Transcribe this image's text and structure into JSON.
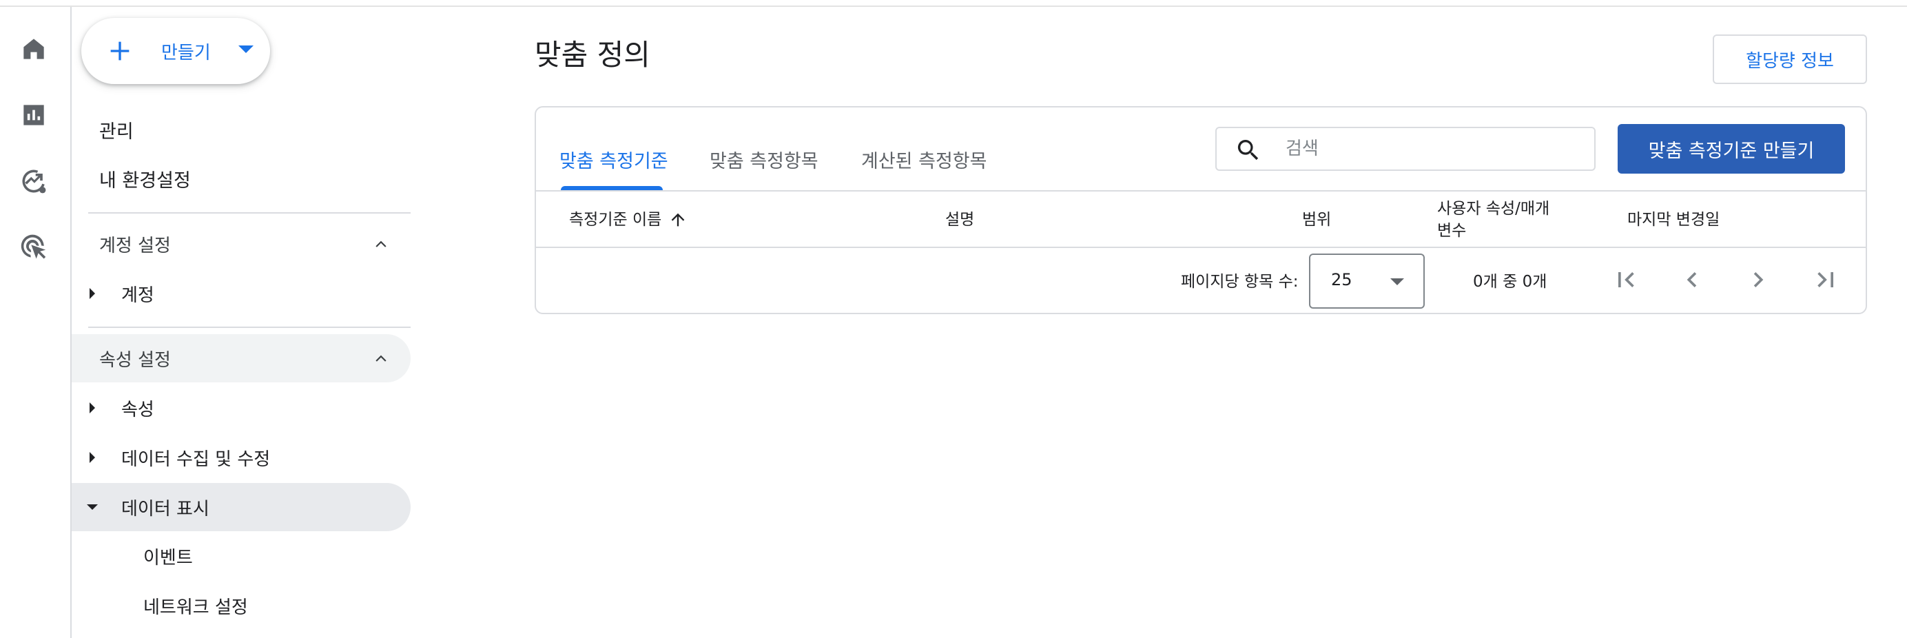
{
  "rail": {
    "icons": [
      "home-icon",
      "reports-icon",
      "explore-icon",
      "advertising-icon"
    ]
  },
  "nav": {
    "create_label": "만들기",
    "admin_label": "관리",
    "prefs_label": "내 환경설정",
    "account_settings_label": "계정 설정",
    "account_label": "계정",
    "property_settings_label": "속성 설정",
    "property_label": "속성",
    "data_collection_label": "데이터 수집 및 수정",
    "data_display_label": "데이터 표시",
    "events_label": "이벤트",
    "network_label": "네트워크 설정"
  },
  "page": {
    "title": "맞춤 정의",
    "quota_label": "할당량 정보"
  },
  "tabs": [
    {
      "label": "맞춤 측정기준",
      "active": true
    },
    {
      "label": "맞춤 측정항목",
      "active": false
    },
    {
      "label": "계산된 측정항목",
      "active": false
    }
  ],
  "search": {
    "placeholder": "검색",
    "value": ""
  },
  "create_dimension_label": "맞춤 측정기준 만들기",
  "table": {
    "columns": [
      "측정기준 이름",
      "설명",
      "범위",
      "사용자 속성/매개\n변수",
      "마지막 변경일"
    ],
    "rows": []
  },
  "pager": {
    "items_per_page_label": "페이지당 항목 수:",
    "items_per_page": "25",
    "count_text": "0개 중 0개"
  },
  "colors": {
    "accent": "#1a73e8",
    "primary_button": "#2b5fb5",
    "border": "#dadce0"
  }
}
